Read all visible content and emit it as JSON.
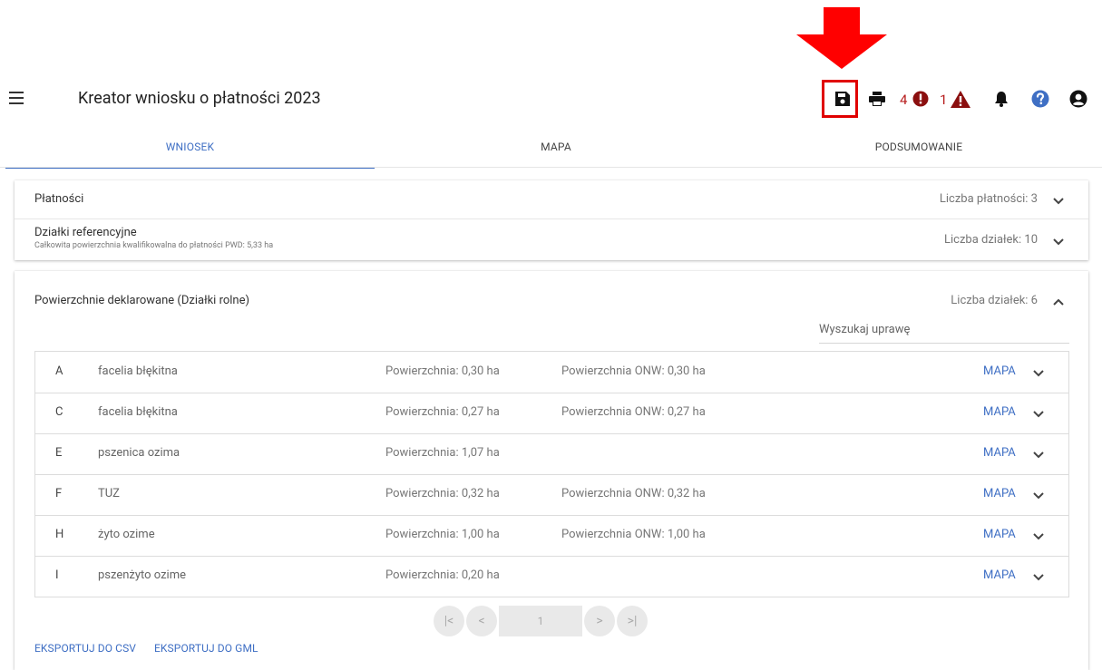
{
  "header": {
    "title": "Kreator wniosku o płatności 2023",
    "errors_count": "4",
    "warnings_count": "1",
    "icons": [
      "menu-icon",
      "save-icon",
      "print-icon",
      "error-icon",
      "warning-icon",
      "bell-icon",
      "help-icon",
      "account-icon"
    ]
  },
  "tabs": [
    {
      "label": "WNIOSEK",
      "active": true
    },
    {
      "label": "MAPA",
      "active": false
    },
    {
      "label": "PODSUMOWANIE",
      "active": false
    }
  ],
  "payments": {
    "title": "Płatności",
    "count_label": "Liczba płatności: 3"
  },
  "reference_parcels": {
    "title": "Działki referencyjne",
    "subtitle": "Całkowita powierzchnia kwalifikowalna do płatności PWD: 5,33 ha",
    "count_label": "Liczba działek: 10"
  },
  "declared": {
    "title": "Powierzchnie deklarowane (Działki rolne)",
    "count_label": "Liczba działek: 6",
    "search_placeholder": "Wyszukaj uprawę",
    "map_label": "MAPA",
    "parcels": [
      {
        "id": "A",
        "crop": "facelia błękitna",
        "area": "Powierzchnia: 0,30 ha",
        "onw": "Powierzchnia ONW: 0,30 ha"
      },
      {
        "id": "C",
        "crop": "facelia błękitna",
        "area": "Powierzchnia: 0,27 ha",
        "onw": "Powierzchnia ONW: 0,27 ha"
      },
      {
        "id": "E",
        "crop": "pszenica ozima",
        "area": "Powierzchnia: 1,07 ha",
        "onw": ""
      },
      {
        "id": "F",
        "crop": "TUZ",
        "area": "Powierzchnia: 0,32 ha",
        "onw": "Powierzchnia ONW: 0,32 ha"
      },
      {
        "id": "H",
        "crop": "żyto ozime",
        "area": "Powierzchnia: 1,00 ha",
        "onw": "Powierzchnia ONW: 1,00 ha"
      },
      {
        "id": "I",
        "crop": "pszenżyto ozime",
        "area": "Powierzchnia: 0,20 ha",
        "onw": ""
      }
    ]
  },
  "pagination": {
    "first": "|<",
    "prev": "<",
    "page": "1",
    "next": ">",
    "last": ">|"
  },
  "export": {
    "csv": "EKSPORTUJ DO CSV",
    "gml": "EKSPORTUJ DO GML"
  },
  "colors": {
    "accent": "#3f6fc4",
    "error": "#b71c1c",
    "annotation": "#ff0000",
    "help": "#3f6fc4"
  }
}
